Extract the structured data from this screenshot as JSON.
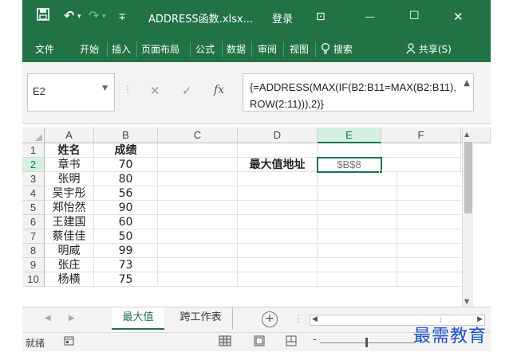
{
  "window": {
    "title": "ADDRESS函数.xlsx...",
    "login_label": "登录",
    "minimize_glyph": "—",
    "maximize_glyph": "☐",
    "close_glyph": "✕",
    "restore_glyph": "⊡"
  },
  "quick_access": {
    "save_icon": "save-icon",
    "undo_glyph": "↶",
    "redo_glyph": "↷",
    "customize_glyph": "∓"
  },
  "ribbon": {
    "tabs": [
      "文件",
      "开始",
      "插入",
      "页面布局",
      "公式",
      "数据",
      "审阅",
      "视图"
    ],
    "search_label": "搜索",
    "share_label": "共享(S)"
  },
  "formula_bar": {
    "name_box": "E2",
    "cancel_glyph": "✕",
    "enter_glyph": "✓",
    "fx_label": "fx",
    "formula": "{=ADDRESS(MAX(IF(B2:B11=MAX(B2:B11),ROW(2:11))),2)}"
  },
  "grid": {
    "columns": [
      "A",
      "B",
      "C",
      "D",
      "E",
      "F"
    ],
    "selected_column": "E",
    "selected_row": "2",
    "rows": [
      {
        "num": "1",
        "A": "姓名",
        "B": "成绩",
        "D": "",
        "E": ""
      },
      {
        "num": "2",
        "A": "章书",
        "B": "70",
        "D": "最大值地址",
        "E": "$B$8"
      },
      {
        "num": "3",
        "A": "张明",
        "B": "80",
        "D": "",
        "E": ""
      },
      {
        "num": "4",
        "A": "吴宇彤",
        "B": "56",
        "D": "",
        "E": ""
      },
      {
        "num": "5",
        "A": "郑怡然",
        "B": "90",
        "D": "",
        "E": ""
      },
      {
        "num": "6",
        "A": "王建国",
        "B": "60",
        "D": "",
        "E": ""
      },
      {
        "num": "7",
        "A": "蔡佳佳",
        "B": "50",
        "D": "",
        "E": ""
      },
      {
        "num": "8",
        "A": "明威",
        "B": "99",
        "D": "",
        "E": ""
      },
      {
        "num": "9",
        "A": "张庄",
        "B": "73",
        "D": "",
        "E": ""
      },
      {
        "num": "10",
        "A": "杨横",
        "B": "75",
        "D": "",
        "E": ""
      }
    ]
  },
  "sheets": {
    "tabs": [
      "最大值",
      "跨工作表"
    ],
    "active": "最大值",
    "add_glyph": "+"
  },
  "status": {
    "ready": "就绪"
  },
  "watermark": "最需教育",
  "colors": {
    "accent": "#217346",
    "selected_header_bg": "#d3f0e0",
    "watermark": "#1f50c8"
  }
}
